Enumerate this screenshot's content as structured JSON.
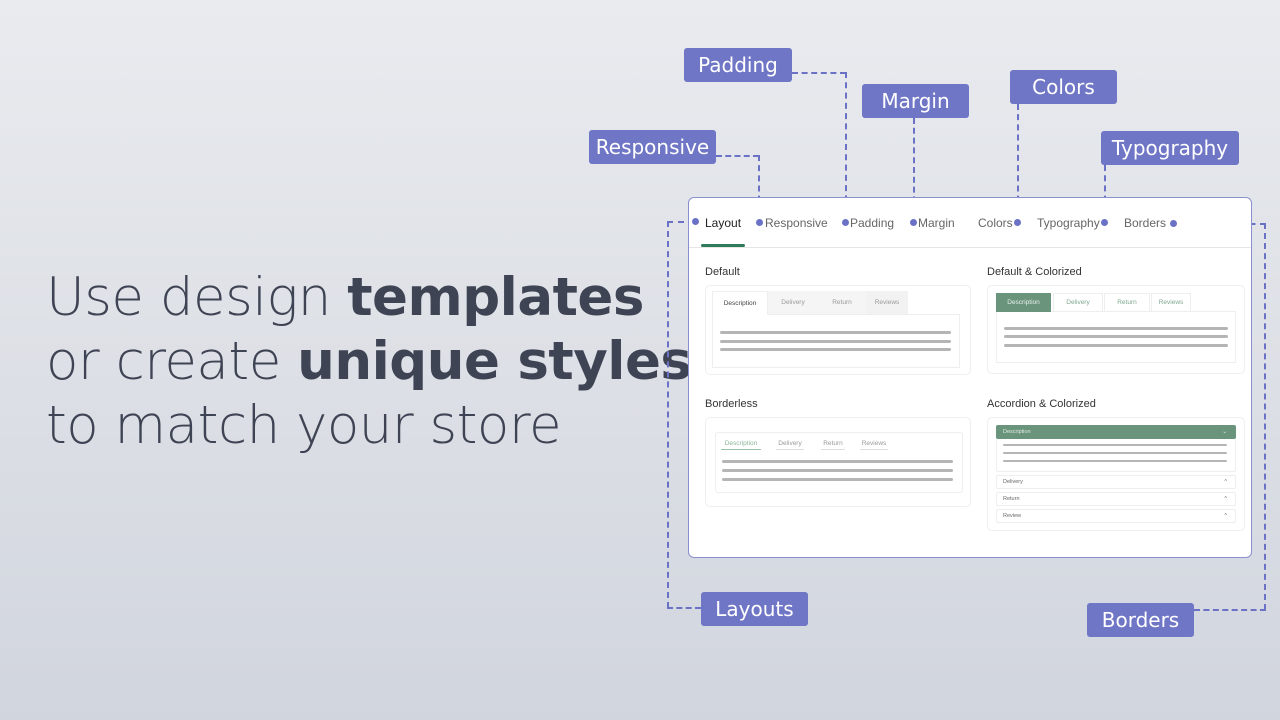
{
  "headline": {
    "line1_pre": "Use design ",
    "line1_bold": "templates",
    "line2_pre": "or create ",
    "line2_bold": "unique styles",
    "line3": "to match your store"
  },
  "callouts": {
    "padding": "Padding",
    "margin": "Margin",
    "colors": "Colors",
    "responsive": "Responsive",
    "typography": "Typography",
    "layouts": "Layouts",
    "borders": "Borders"
  },
  "tabs": [
    "Layout",
    "Responsive",
    "Padding",
    "Margin",
    "Colors",
    "Typography",
    "Borders"
  ],
  "sections": {
    "default": {
      "title": "Default",
      "tabs": [
        "Description",
        "Delivery",
        "Return",
        "Reviews"
      ]
    },
    "default_colorized": {
      "title": "Default & Colorized",
      "tabs": [
        "Description",
        "Delivery",
        "Return",
        "Reviews"
      ]
    },
    "borderless": {
      "title": "Borderless",
      "tabs": [
        "Description",
        "Delivery",
        "Return",
        "Reviews"
      ]
    },
    "accordion_colorized": {
      "title": "Accordion & Colorized",
      "items": [
        "Description",
        "Delivery",
        "Return",
        "Review"
      ]
    }
  },
  "colors": {
    "accent": "#7076c6",
    "green": "#6a957c",
    "active_underline": "#2e7a5a"
  }
}
